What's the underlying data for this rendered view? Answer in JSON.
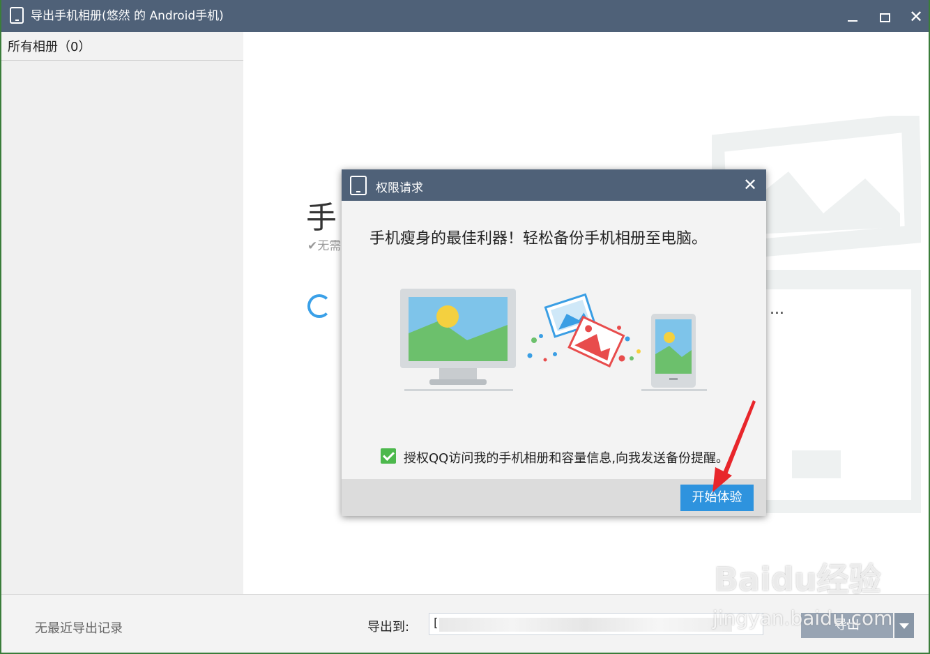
{
  "window": {
    "title": "导出手机相册(悠然 的 Android手机)",
    "minimize_label": "",
    "maximize_label": "",
    "close_label": "✕"
  },
  "sidebar": {
    "album_label": "所有相册（0）"
  },
  "background": {
    "heading": "手",
    "check_text": "✔无需",
    "ellipsis": "..."
  },
  "dialog": {
    "title": "权限请求",
    "close_label": "✕",
    "headline": "手机瘦身的最佳利器！轻松备份手机相册至电脑。",
    "consent_checked": true,
    "consent_text": "授权QQ访问我的手机相册和容量信息,向我发送备份提醒。",
    "start_button": "开始体验"
  },
  "bottombar": {
    "recent_text": "无最近导出记录",
    "export_label": "导出到:",
    "export_path": "[",
    "export_button": "导出"
  },
  "watermark": {
    "brand": "Baidu经验",
    "url": "jingyan.baidu.com"
  },
  "colors": {
    "titlebar": "#4f6178",
    "accent_button": "#2e93de",
    "checkbox": "#4cb84c",
    "arrow": "#e8262b"
  }
}
